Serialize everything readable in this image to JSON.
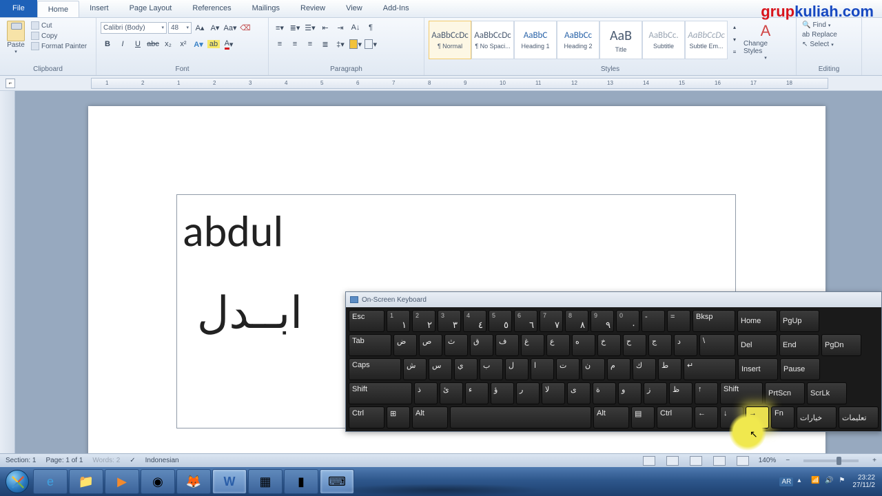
{
  "watermark": {
    "p1": "grup",
    "p2": "kuliah.com"
  },
  "tabs": {
    "file": "File",
    "list": [
      "Home",
      "Insert",
      "Page Layout",
      "References",
      "Mailings",
      "Review",
      "View",
      "Add-Ins"
    ],
    "active": 0
  },
  "clipboard": {
    "label": "Clipboard",
    "paste": "Paste",
    "cut": "Cut",
    "copy": "Copy",
    "fmt": "Format Painter"
  },
  "font": {
    "label": "Font",
    "name": "Calibri (Body)",
    "size": "48",
    "b": "B",
    "i": "I",
    "u": "U",
    "s": "abc",
    "sub": "x₂",
    "sup": "x²"
  },
  "paragraph": {
    "label": "Paragraph"
  },
  "styles": {
    "label": "Styles",
    "items": [
      {
        "prev": "AaBbCcDc",
        "name": "¶ Normal",
        "cls": ""
      },
      {
        "prev": "AaBbCcDc",
        "name": "¶ No Spaci...",
        "cls": ""
      },
      {
        "prev": "AaBbC",
        "name": "Heading 1",
        "cls": "blue"
      },
      {
        "prev": "AaBbCc",
        "name": "Heading 2",
        "cls": "blue"
      },
      {
        "prev": "AaB",
        "name": "Title",
        "cls": ""
      },
      {
        "prev": "AaBbCc.",
        "name": "Subtitle",
        "cls": "gray"
      },
      {
        "prev": "AaBbCcDc",
        "name": "Subtle Em...",
        "cls": "gray"
      }
    ],
    "change": "Change Styles"
  },
  "editing": {
    "label": "Editing",
    "find": "Find",
    "replace": "Replace",
    "select": "Select"
  },
  "ruler": {
    "marks": [
      "1",
      "2",
      "1",
      "2",
      "3",
      "4",
      "5",
      "6",
      "7",
      "8",
      "9",
      "10",
      "11",
      "12",
      "13",
      "14",
      "15",
      "16",
      "17",
      "18"
    ]
  },
  "doc": {
    "line1": "abdul",
    "line2": "ابــدل"
  },
  "osk": {
    "title": "On-Screen Keyboard",
    "r1": [
      "Esc",
      "1 ١",
      "2 ٢",
      "3 ٣",
      "4 ٤",
      "5 ٥",
      "6 ٦",
      "7 ٧",
      "8 ٨",
      "9 ٩",
      "0 ٠",
      "-",
      "=",
      "Bksp",
      "Home",
      "PgUp"
    ],
    "r2": [
      "Tab",
      "ض",
      "ص",
      "ث",
      "ق",
      "ف",
      "غ",
      "ع",
      "ه",
      "خ",
      "ح",
      "ج",
      "د",
      "\\",
      "Del",
      "End",
      "PgDn"
    ],
    "r3": [
      "Caps",
      "ش",
      "س",
      "ي",
      "ب",
      "ل",
      "ا",
      "ت",
      "ن",
      "م",
      "ك",
      "ط",
      "↵",
      "Insert",
      "Pause"
    ],
    "r4": [
      "Shift",
      "ذ",
      "ئ",
      "ء",
      "ؤ",
      "ر",
      "لا",
      "ى",
      "ة",
      "و",
      "ز",
      "ظ",
      "↑",
      "Shift",
      "PrtScn",
      "ScrLk"
    ],
    "r5": [
      "Ctrl",
      "⊞",
      "Alt",
      " ",
      "Alt",
      "▤",
      "Ctrl",
      "←",
      "↓",
      "→",
      "Fn",
      "خيارات",
      "تعليمات"
    ]
  },
  "status": {
    "section": "Section: 1",
    "page": "Page: 1 of 1",
    "words": "Words: 2",
    "lang": "Indonesian",
    "zoom": "140%"
  },
  "tray": {
    "lang": "AR",
    "time": "23:22",
    "date": "27/11/2"
  }
}
